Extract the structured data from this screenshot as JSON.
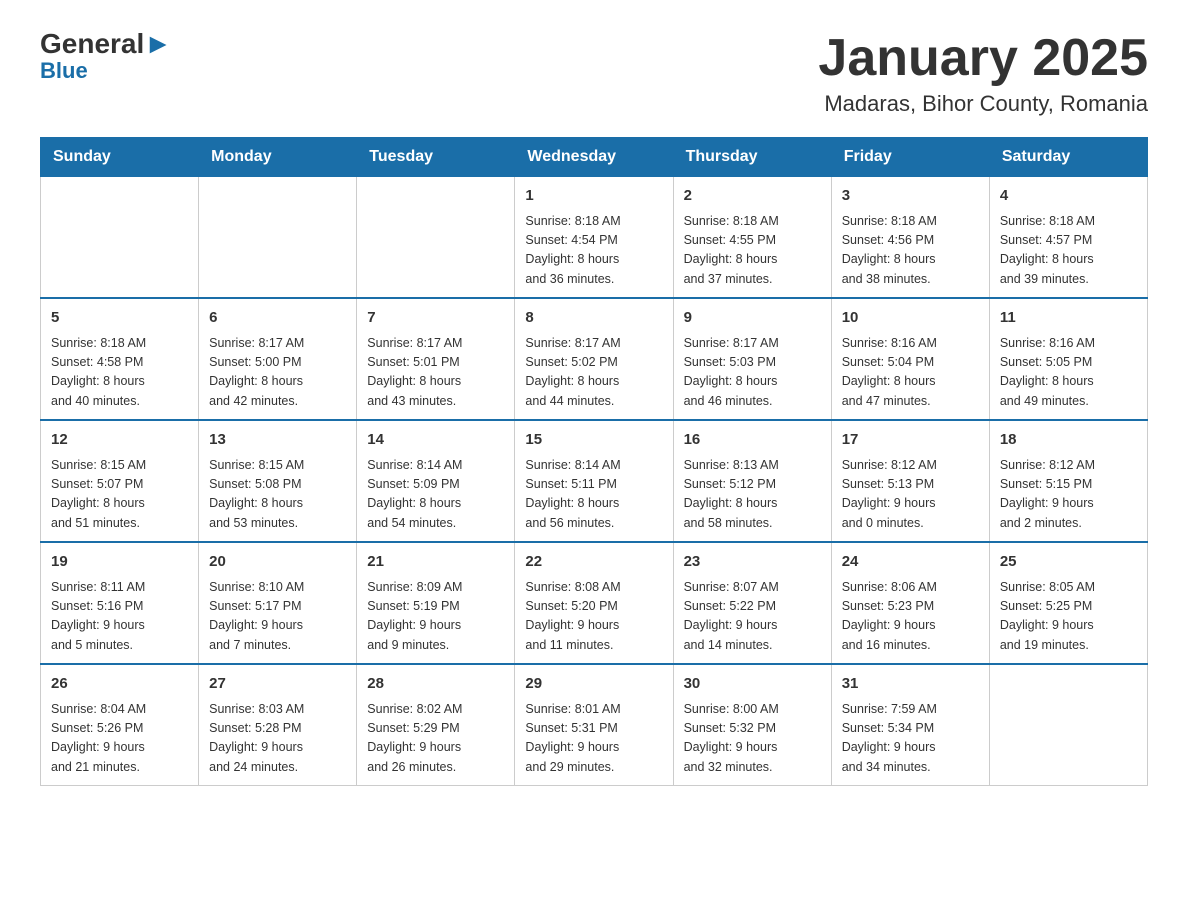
{
  "logo": {
    "general": "General",
    "blue": "Blue"
  },
  "title": "January 2025",
  "subtitle": "Madaras, Bihor County, Romania",
  "days_header": [
    "Sunday",
    "Monday",
    "Tuesday",
    "Wednesday",
    "Thursday",
    "Friday",
    "Saturday"
  ],
  "weeks": [
    [
      {
        "day": "",
        "info": ""
      },
      {
        "day": "",
        "info": ""
      },
      {
        "day": "",
        "info": ""
      },
      {
        "day": "1",
        "info": "Sunrise: 8:18 AM\nSunset: 4:54 PM\nDaylight: 8 hours\nand 36 minutes."
      },
      {
        "day": "2",
        "info": "Sunrise: 8:18 AM\nSunset: 4:55 PM\nDaylight: 8 hours\nand 37 minutes."
      },
      {
        "day": "3",
        "info": "Sunrise: 8:18 AM\nSunset: 4:56 PM\nDaylight: 8 hours\nand 38 minutes."
      },
      {
        "day": "4",
        "info": "Sunrise: 8:18 AM\nSunset: 4:57 PM\nDaylight: 8 hours\nand 39 minutes."
      }
    ],
    [
      {
        "day": "5",
        "info": "Sunrise: 8:18 AM\nSunset: 4:58 PM\nDaylight: 8 hours\nand 40 minutes."
      },
      {
        "day": "6",
        "info": "Sunrise: 8:17 AM\nSunset: 5:00 PM\nDaylight: 8 hours\nand 42 minutes."
      },
      {
        "day": "7",
        "info": "Sunrise: 8:17 AM\nSunset: 5:01 PM\nDaylight: 8 hours\nand 43 minutes."
      },
      {
        "day": "8",
        "info": "Sunrise: 8:17 AM\nSunset: 5:02 PM\nDaylight: 8 hours\nand 44 minutes."
      },
      {
        "day": "9",
        "info": "Sunrise: 8:17 AM\nSunset: 5:03 PM\nDaylight: 8 hours\nand 46 minutes."
      },
      {
        "day": "10",
        "info": "Sunrise: 8:16 AM\nSunset: 5:04 PM\nDaylight: 8 hours\nand 47 minutes."
      },
      {
        "day": "11",
        "info": "Sunrise: 8:16 AM\nSunset: 5:05 PM\nDaylight: 8 hours\nand 49 minutes."
      }
    ],
    [
      {
        "day": "12",
        "info": "Sunrise: 8:15 AM\nSunset: 5:07 PM\nDaylight: 8 hours\nand 51 minutes."
      },
      {
        "day": "13",
        "info": "Sunrise: 8:15 AM\nSunset: 5:08 PM\nDaylight: 8 hours\nand 53 minutes."
      },
      {
        "day": "14",
        "info": "Sunrise: 8:14 AM\nSunset: 5:09 PM\nDaylight: 8 hours\nand 54 minutes."
      },
      {
        "day": "15",
        "info": "Sunrise: 8:14 AM\nSunset: 5:11 PM\nDaylight: 8 hours\nand 56 minutes."
      },
      {
        "day": "16",
        "info": "Sunrise: 8:13 AM\nSunset: 5:12 PM\nDaylight: 8 hours\nand 58 minutes."
      },
      {
        "day": "17",
        "info": "Sunrise: 8:12 AM\nSunset: 5:13 PM\nDaylight: 9 hours\nand 0 minutes."
      },
      {
        "day": "18",
        "info": "Sunrise: 8:12 AM\nSunset: 5:15 PM\nDaylight: 9 hours\nand 2 minutes."
      }
    ],
    [
      {
        "day": "19",
        "info": "Sunrise: 8:11 AM\nSunset: 5:16 PM\nDaylight: 9 hours\nand 5 minutes."
      },
      {
        "day": "20",
        "info": "Sunrise: 8:10 AM\nSunset: 5:17 PM\nDaylight: 9 hours\nand 7 minutes."
      },
      {
        "day": "21",
        "info": "Sunrise: 8:09 AM\nSunset: 5:19 PM\nDaylight: 9 hours\nand 9 minutes."
      },
      {
        "day": "22",
        "info": "Sunrise: 8:08 AM\nSunset: 5:20 PM\nDaylight: 9 hours\nand 11 minutes."
      },
      {
        "day": "23",
        "info": "Sunrise: 8:07 AM\nSunset: 5:22 PM\nDaylight: 9 hours\nand 14 minutes."
      },
      {
        "day": "24",
        "info": "Sunrise: 8:06 AM\nSunset: 5:23 PM\nDaylight: 9 hours\nand 16 minutes."
      },
      {
        "day": "25",
        "info": "Sunrise: 8:05 AM\nSunset: 5:25 PM\nDaylight: 9 hours\nand 19 minutes."
      }
    ],
    [
      {
        "day": "26",
        "info": "Sunrise: 8:04 AM\nSunset: 5:26 PM\nDaylight: 9 hours\nand 21 minutes."
      },
      {
        "day": "27",
        "info": "Sunrise: 8:03 AM\nSunset: 5:28 PM\nDaylight: 9 hours\nand 24 minutes."
      },
      {
        "day": "28",
        "info": "Sunrise: 8:02 AM\nSunset: 5:29 PM\nDaylight: 9 hours\nand 26 minutes."
      },
      {
        "day": "29",
        "info": "Sunrise: 8:01 AM\nSunset: 5:31 PM\nDaylight: 9 hours\nand 29 minutes."
      },
      {
        "day": "30",
        "info": "Sunrise: 8:00 AM\nSunset: 5:32 PM\nDaylight: 9 hours\nand 32 minutes."
      },
      {
        "day": "31",
        "info": "Sunrise: 7:59 AM\nSunset: 5:34 PM\nDaylight: 9 hours\nand 34 minutes."
      },
      {
        "day": "",
        "info": ""
      }
    ]
  ]
}
